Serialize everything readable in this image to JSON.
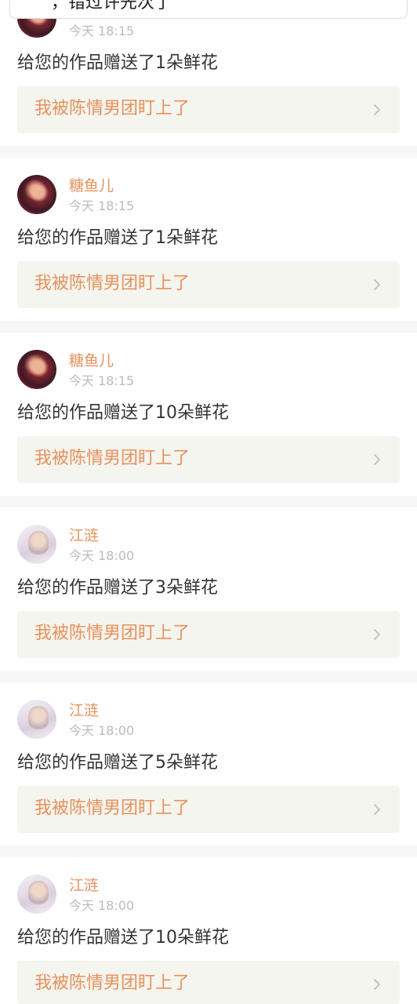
{
  "toast": {
    "text": "，错过许先次了"
  },
  "link_label": "我被陈情男团盯上了",
  "posts": [
    {
      "username": "",
      "time": "今天 18:15",
      "message": "给您的作品赠送了1朵鲜花",
      "avatar": "dark"
    },
    {
      "username": "糖鱼儿",
      "time": "今天 18:15",
      "message": "给您的作品赠送了1朵鲜花",
      "avatar": "dark"
    },
    {
      "username": "糖鱼儿",
      "time": "今天 18:15",
      "message": "给您的作品赠送了10朵鲜花",
      "avatar": "dark"
    },
    {
      "username": "江涟",
      "time": "今天 18:00",
      "message": "给您的作品赠送了3朵鲜花",
      "avatar": "light"
    },
    {
      "username": "江涟",
      "time": "今天 18:00",
      "message": "给您的作品赠送了5朵鲜花",
      "avatar": "light"
    },
    {
      "username": "江涟",
      "time": "今天 18:00",
      "message": "给您的作品赠送了10朵鲜花",
      "avatar": "light"
    }
  ],
  "colors": {
    "accent": "#e8915c",
    "link_bg": "#f5f5ef",
    "time": "#bbbbbb",
    "separator": "#f6f6f6"
  },
  "icons": {
    "chevron": "chevron-right-icon"
  }
}
